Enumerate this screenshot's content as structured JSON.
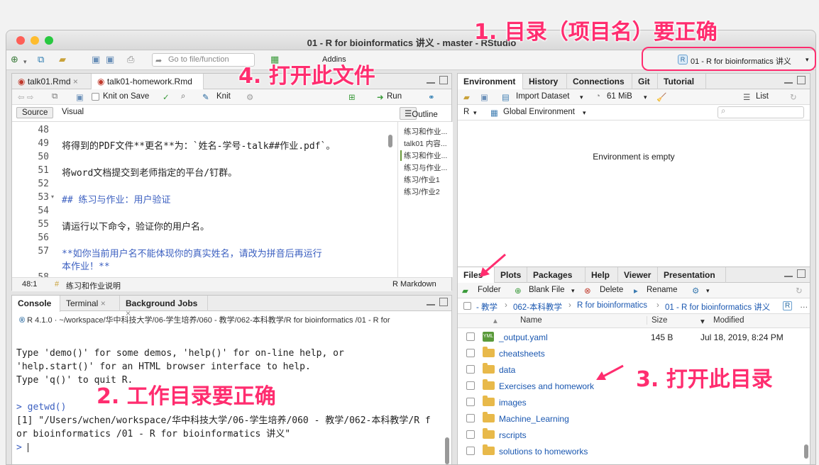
{
  "window": {
    "title": "01 - R for bioinformatics 讲义 - master - RStudio"
  },
  "toolbar": {
    "goto_placeholder": "Go to file/function",
    "addins": "Addins",
    "project": "01 - R for bioinformatics 讲义"
  },
  "source": {
    "tabs": [
      "talk01.Rmd",
      "talk01-homework.Rmd"
    ],
    "knit_on_save": "Knit on Save",
    "knit": "Knit",
    "run": "Run",
    "mode_source": "Source",
    "mode_visual": "Visual",
    "outline": "Outline",
    "lines": [
      {
        "n": "48",
        "text": ""
      },
      {
        "n": "49",
        "text": "将得到的PDF文件**更名**为：`姓名-学号-talk##作业.pdf`。"
      },
      {
        "n": "50",
        "text": ""
      },
      {
        "n": "51",
        "text": "将word文档提交到老师指定的平台/钉群。"
      },
      {
        "n": "52",
        "text": ""
      },
      {
        "n": "53",
        "text": "## 练习与作业：用户验证"
      },
      {
        "n": "54",
        "text": ""
      },
      {
        "n": "55",
        "text": "请运行以下命令，验证你的用户名。"
      },
      {
        "n": "56",
        "text": ""
      },
      {
        "n": "57",
        "text": "**如你当前用户名不能体现你的真实姓名，请改为拼音后再运行"
      },
      {
        "n": "",
        "text": "本作业！**"
      },
      {
        "n": "58",
        "text": ""
      }
    ],
    "outline_items": [
      "练习和作业...",
      "talk01 内容...",
      "练习和作业...",
      "练习与作业...",
      "练习/作业1",
      "练习/作业2"
    ],
    "status_pos": "48:1",
    "status_section": "练习和作业说明",
    "status_mode": "R Markdown"
  },
  "console": {
    "tabs": [
      "Console",
      "Terminal",
      "Background Jobs"
    ],
    "path": "R 4.1.0 · ~/workspace/华中科技大学/06-学生培养/060 - 教学/062-本科教学/R for bioinformatics /01 - R for",
    "lines": [
      "Type 'demo()' for some demos, 'help()' for on-line help, or",
      "'help.start()' for an HTML browser interface to help.",
      "Type 'q()' to quit R.",
      "",
      "> getwd()",
      "[1] \"/Users/wchen/workspace/华中科技大学/06-学生培养/060 - 教学/062-本科教学/R f",
      "or bioinformatics /01 - R for bioinformatics 讲义\"",
      ">"
    ]
  },
  "env": {
    "tabs": [
      "Environment",
      "History",
      "Connections",
      "Git",
      "Tutorial"
    ],
    "import": "Import Dataset",
    "mem": "61 MiB",
    "list": "List",
    "r_label": "R",
    "global": "Global Environment",
    "empty": "Environment is empty"
  },
  "files": {
    "tabs": [
      "Files",
      "Plots",
      "Packages",
      "Help",
      "Viewer",
      "Presentation"
    ],
    "actions": [
      "Folder",
      "Blank File",
      "Delete",
      "Rename"
    ],
    "breadcrumb": [
      "- 教学",
      "062-本科教学",
      "R for bioinformatics",
      "01 - R for bioinformatics 讲义"
    ],
    "headers": {
      "name": "Name",
      "size": "Size",
      "modified": "Modified"
    },
    "rows": [
      {
        "name": "_output.yaml",
        "size": "145 B",
        "modified": "Jul 18, 2019, 8:24 PM",
        "type": "file"
      },
      {
        "name": "cheatsheets",
        "size": "",
        "modified": "",
        "type": "folder"
      },
      {
        "name": "data",
        "size": "",
        "modified": "",
        "type": "folder"
      },
      {
        "name": "Exercises and homework",
        "size": "",
        "modified": "",
        "type": "folder"
      },
      {
        "name": "images",
        "size": "",
        "modified": "",
        "type": "folder"
      },
      {
        "name": "Machine_Learning",
        "size": "",
        "modified": "",
        "type": "folder"
      },
      {
        "name": "rscripts",
        "size": "",
        "modified": "",
        "type": "folder"
      },
      {
        "name": "solutions to homeworks",
        "size": "",
        "modified": "",
        "type": "folder"
      }
    ]
  },
  "annotations": {
    "a1": "1. 目录（项目名）要正确",
    "a2": "2. 工作目录要正确",
    "a3": "3. 打开此目录",
    "a4": "4. 打开此文件"
  },
  "colors": {
    "annotation": "#ff2d6f",
    "link": "#1a57b0",
    "heading": "#3b5fc0"
  }
}
